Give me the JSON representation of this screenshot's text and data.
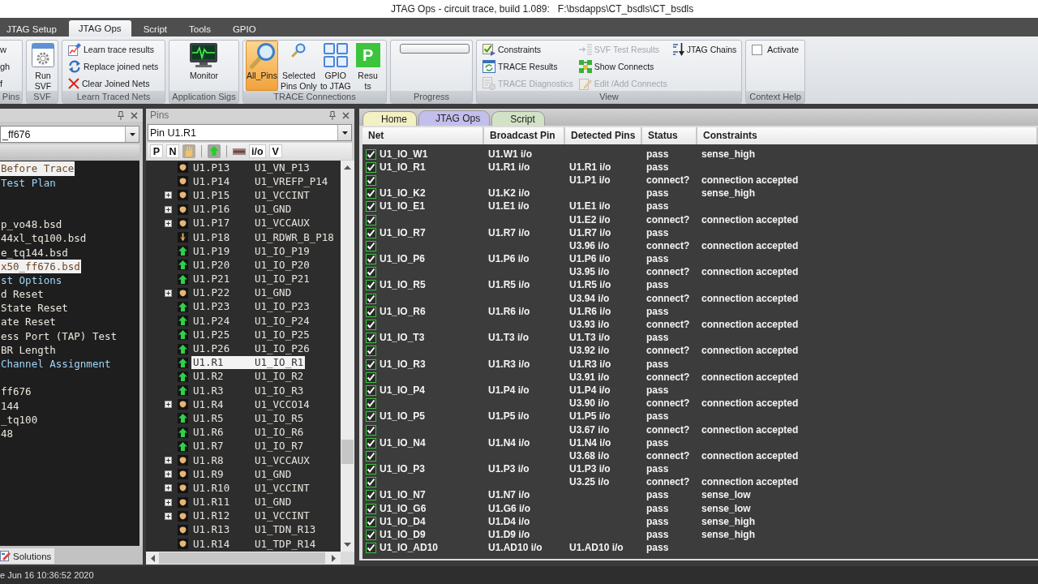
{
  "window": {
    "title": "JTAG Ops - circuit trace, build 1.089:   F:\\bsdapps\\CT_bsdls\\CT_bsdls"
  },
  "ribbon_tabs": [
    {
      "label": "JTAG Setup",
      "selected": false
    },
    {
      "label": "JTAG Ops",
      "selected": true
    },
    {
      "label": "Script",
      "selected": false
    },
    {
      "label": "Tools",
      "selected": false
    },
    {
      "label": "GPIO",
      "selected": false
    }
  ],
  "ribbon_groups": [
    {
      "label": "Pins",
      "items": [
        {
          "kind": "small",
          "label": "w",
          "disabled": false
        },
        {
          "kind": "small",
          "label": "gh",
          "disabled": false
        },
        {
          "kind": "small",
          "label": "f",
          "disabled": false
        }
      ]
    },
    {
      "label": "SVF",
      "items": [
        {
          "kind": "large",
          "label": "Run\nSVF",
          "selected": false
        }
      ]
    },
    {
      "label": "Learn Traced Nets",
      "items": [
        {
          "kind": "small",
          "label": "Learn trace results",
          "disabled": false
        },
        {
          "kind": "small",
          "label": "Replace joined nets",
          "disabled": false
        },
        {
          "kind": "small",
          "label": "Clear Joined Nets",
          "disabled": false
        }
      ]
    },
    {
      "label": "Application Sigs",
      "items": [
        {
          "kind": "large",
          "label": "Monitor",
          "selected": false
        }
      ]
    },
    {
      "label": "TRACE Connections",
      "items": [
        {
          "kind": "large",
          "label": "All_Pins",
          "selected": true
        },
        {
          "kind": "large",
          "label": "Selected\nPins Only",
          "selected": false
        },
        {
          "kind": "large",
          "label": "GPIO\nto JTAG",
          "selected": false
        },
        {
          "kind": "large",
          "label": "Resu\nts",
          "tile": "P",
          "selected": false
        }
      ]
    },
    {
      "label": "Progress",
      "items": [
        {
          "kind": "progress",
          "level": 0
        }
      ]
    },
    {
      "label": "View",
      "items": [
        {
          "kind": "small",
          "label": "Constraints",
          "disabled": false
        },
        {
          "kind": "small",
          "label": "TRACE Results",
          "disabled": false
        },
        {
          "kind": "small",
          "label": "TRACE Diagnostics",
          "disabled": true
        },
        {
          "kind": "small",
          "label": "SVF Test Results",
          "disabled": true
        },
        {
          "kind": "small",
          "label": "Show Connects",
          "disabled": false
        },
        {
          "kind": "small",
          "label": "Edit /Add Connects",
          "disabled": true
        },
        {
          "kind": "small",
          "label": "JTAG Chains",
          "disabled": false
        }
      ]
    },
    {
      "label": "Context Help",
      "items": [
        {
          "kind": "check",
          "label": "Activate",
          "checked": false
        }
      ]
    }
  ],
  "left_panel": {
    "dropdown": "_ff676",
    "sections": [
      {
        "items": [
          {
            "label": "Before Trace",
            "kind": "leaf",
            "selected": true
          },
          {
            "label": "Test Plan",
            "kind": "group",
            "selected": false
          }
        ]
      },
      {
        "items": [
          {
            "label": "p_vo48.bsd",
            "kind": "leaf",
            "selected": false
          },
          {
            "label": "44xl_tq100.bsd",
            "kind": "leaf",
            "selected": false
          },
          {
            "label": "e_tq144.bsd",
            "kind": "leaf",
            "selected": false
          },
          {
            "label": "x50_ff676.bsd",
            "kind": "leaf",
            "selected": true
          },
          {
            "label": "st Options",
            "kind": "group",
            "selected": false
          },
          {
            "label": "d Reset",
            "kind": "leaf",
            "selected": false
          },
          {
            "label": "State Reset",
            "kind": "leaf",
            "selected": false
          },
          {
            "label": "ate Reset",
            "kind": "leaf",
            "selected": false
          },
          {
            "label": "ess Port (TAP) Test",
            "kind": "leaf",
            "selected": false
          },
          {
            "label": "BR Length",
            "kind": "leaf",
            "selected": false
          },
          {
            "label": "Channel Assignment",
            "kind": "group",
            "selected": false
          }
        ]
      },
      {
        "items": [
          {
            "label": "ff676",
            "kind": "leaf",
            "selected": false
          },
          {
            "label": "144",
            "kind": "leaf",
            "selected": false
          },
          {
            "label": "_tq100",
            "kind": "leaf",
            "selected": false
          },
          {
            "label": "48",
            "kind": "leaf",
            "selected": false
          }
        ]
      }
    ],
    "tab": "Solutions"
  },
  "pins_panel": {
    "title": "Pins",
    "dropdown": "Pin U1.R1",
    "toolbar": [
      {
        "kind": "text",
        "label": "P"
      },
      {
        "kind": "text",
        "label": "N"
      },
      {
        "kind": "icon"
      },
      {
        "kind": "separator"
      },
      {
        "kind": "icon"
      },
      {
        "kind": "separator"
      },
      {
        "kind": "icon"
      },
      {
        "kind": "text",
        "label": "i/o"
      },
      {
        "kind": "text",
        "label": "V"
      }
    ],
    "rows": [
      {
        "pin": "U1.P13",
        "net": "U1_VN_P13",
        "kind": "other",
        "expandable": false,
        "selected": false
      },
      {
        "pin": "U1.P14",
        "net": "U1_VREFP_P14",
        "kind": "other",
        "expandable": false,
        "selected": false
      },
      {
        "pin": "U1.P15",
        "net": "U1_VCCINT",
        "kind": "other",
        "expandable": true,
        "selected": false
      },
      {
        "pin": "U1.P16",
        "net": "U1_GND",
        "kind": "other",
        "expandable": true,
        "selected": false
      },
      {
        "pin": "U1.P17",
        "net": "U1_VCCAUX",
        "kind": "other",
        "expandable": true,
        "selected": false
      },
      {
        "pin": "U1.P18",
        "net": "U1_RDWR_B_P18",
        "kind": "input",
        "expandable": false,
        "selected": false
      },
      {
        "pin": "U1.P19",
        "net": "U1_IO_P19",
        "kind": "io",
        "expandable": false,
        "selected": false
      },
      {
        "pin": "U1.P20",
        "net": "U1_IO_P20",
        "kind": "io",
        "expandable": false,
        "selected": false
      },
      {
        "pin": "U1.P21",
        "net": "U1_IO_P21",
        "kind": "io",
        "expandable": false,
        "selected": false
      },
      {
        "pin": "U1.P22",
        "net": "U1_GND",
        "kind": "other",
        "expandable": true,
        "selected": false
      },
      {
        "pin": "U1.P23",
        "net": "U1_IO_P23",
        "kind": "io",
        "expandable": false,
        "selected": false
      },
      {
        "pin": "U1.P24",
        "net": "U1_IO_P24",
        "kind": "io",
        "expandable": false,
        "selected": false
      },
      {
        "pin": "U1.P25",
        "net": "U1_IO_P25",
        "kind": "io",
        "expandable": false,
        "selected": false
      },
      {
        "pin": "U1.P26",
        "net": "U1_IO_P26",
        "kind": "io",
        "expandable": false,
        "selected": false
      },
      {
        "pin": "U1.R1",
        "net": "U1_IO_R1",
        "kind": "io",
        "expandable": false,
        "selected": true
      },
      {
        "pin": "U1.R2",
        "net": "U1_IO_R2",
        "kind": "io",
        "expandable": false,
        "selected": false
      },
      {
        "pin": "U1.R3",
        "net": "U1_IO_R3",
        "kind": "io",
        "expandable": false,
        "selected": false
      },
      {
        "pin": "U1.R4",
        "net": "U1_VCCO14",
        "kind": "other",
        "expandable": true,
        "selected": false
      },
      {
        "pin": "U1.R5",
        "net": "U1_IO_R5",
        "kind": "io",
        "expandable": false,
        "selected": false
      },
      {
        "pin": "U1.R6",
        "net": "U1_IO_R6",
        "kind": "io",
        "expandable": false,
        "selected": false
      },
      {
        "pin": "U1.R7",
        "net": "U1_IO_R7",
        "kind": "io",
        "expandable": false,
        "selected": false
      },
      {
        "pin": "U1.R8",
        "net": "U1_VCCAUX",
        "kind": "other",
        "expandable": true,
        "selected": false
      },
      {
        "pin": "U1.R9",
        "net": "U1_GND",
        "kind": "other",
        "expandable": true,
        "selected": false
      },
      {
        "pin": "U1.R10",
        "net": "U1_VCCINT",
        "kind": "other",
        "expandable": true,
        "selected": false
      },
      {
        "pin": "U1.R11",
        "net": "U1_GND",
        "kind": "other",
        "expandable": true,
        "selected": false
      },
      {
        "pin": "U1.R12",
        "net": "U1_VCCINT",
        "kind": "other",
        "expandable": true,
        "selected": false
      },
      {
        "pin": "U1.R13",
        "net": "U1_TDN_R13",
        "kind": "other",
        "expandable": false,
        "selected": false
      },
      {
        "pin": "U1.R14",
        "net": "U1_TDP_R14",
        "kind": "other",
        "expandable": false,
        "selected": false
      }
    ]
  },
  "document_tabs": [
    {
      "label": "Home",
      "selected": false,
      "color": "#f3f0c4"
    },
    {
      "label": "JTAG Ops",
      "selected": true,
      "color": "#c3bfec"
    },
    {
      "label": "Script",
      "selected": false,
      "color": "#d2e2c6"
    }
  ],
  "table": {
    "columns": [
      {
        "label": "Net"
      },
      {
        "label": "Broadcast Pin"
      },
      {
        "label": "Detected Pins"
      },
      {
        "label": "Status"
      },
      {
        "label": "Constraints"
      }
    ],
    "rows": [
      {
        "checked": true,
        "net": "U1_IO_W1",
        "broadcast_pin": "U1.W1 i/o",
        "status": "pass",
        "constraints": "sense_high"
      },
      {
        "checked": true,
        "net": "U1_IO_R1",
        "broadcast_pin": "U1.R1 i/o",
        "detected_pins": "U1.R1 i/o",
        "status": "pass"
      },
      {
        "checked": true,
        "detected_pins": "U1.P1 i/o",
        "status": "connect?",
        "constraints": "connection accepted"
      },
      {
        "checked": true,
        "net": "U1_IO_K2",
        "broadcast_pin": "U1.K2 i/o",
        "status": "pass",
        "constraints": "sense_high"
      },
      {
        "checked": true,
        "net": "U1_IO_E1",
        "broadcast_pin": "U1.E1 i/o",
        "detected_pins": "U1.E1 i/o",
        "status": "pass"
      },
      {
        "checked": true,
        "detected_pins": "U1.E2 i/o",
        "status": "connect?",
        "constraints": "connection accepted"
      },
      {
        "checked": true,
        "net": "U1_IO_R7",
        "broadcast_pin": "U1.R7 i/o",
        "detected_pins": "U1.R7 i/o",
        "status": "pass"
      },
      {
        "checked": true,
        "detected_pins": "U3.96 i/o",
        "status": "connect?",
        "constraints": "connection accepted"
      },
      {
        "checked": true,
        "net": "U1_IO_P6",
        "broadcast_pin": "U1.P6 i/o",
        "detected_pins": "U1.P6 i/o",
        "status": "pass"
      },
      {
        "checked": true,
        "detected_pins": "U3.95 i/o",
        "status": "connect?",
        "constraints": "connection accepted"
      },
      {
        "checked": true,
        "net": "U1_IO_R5",
        "broadcast_pin": "U1.R5 i/o",
        "detected_pins": "U1.R5 i/o",
        "status": "pass"
      },
      {
        "checked": true,
        "detected_pins": "U3.94 i/o",
        "status": "connect?",
        "constraints": "connection accepted"
      },
      {
        "checked": true,
        "net": "U1_IO_R6",
        "broadcast_pin": "U1.R6 i/o",
        "detected_pins": "U1.R6 i/o",
        "status": "pass"
      },
      {
        "checked": true,
        "detected_pins": "U3.93 i/o",
        "status": "connect?",
        "constraints": "connection accepted"
      },
      {
        "checked": true,
        "net": "U1_IO_T3",
        "broadcast_pin": "U1.T3 i/o",
        "detected_pins": "U1.T3 i/o",
        "status": "pass"
      },
      {
        "checked": true,
        "detected_pins": "U3.92 i/o",
        "status": "connect?",
        "constraints": "connection accepted"
      },
      {
        "checked": true,
        "net": "U1_IO_R3",
        "broadcast_pin": "U1.R3 i/o",
        "detected_pins": "U1.R3 i/o",
        "status": "pass"
      },
      {
        "checked": true,
        "detected_pins": "U3.91 i/o",
        "status": "connect?",
        "constraints": "connection accepted"
      },
      {
        "checked": true,
        "net": "U1_IO_P4",
        "broadcast_pin": "U1.P4 i/o",
        "detected_pins": "U1.P4 i/o",
        "status": "pass"
      },
      {
        "checked": true,
        "detected_pins": "U3.90 i/o",
        "status": "connect?",
        "constraints": "connection accepted"
      },
      {
        "checked": true,
        "net": "U1_IO_P5",
        "broadcast_pin": "U1.P5 i/o",
        "detected_pins": "U1.P5 i/o",
        "status": "pass"
      },
      {
        "checked": true,
        "detected_pins": "U3.67 i/o",
        "status": "connect?",
        "constraints": "connection accepted"
      },
      {
        "checked": true,
        "net": "U1_IO_N4",
        "broadcast_pin": "U1.N4 i/o",
        "detected_pins": "U1.N4 i/o",
        "status": "pass"
      },
      {
        "checked": true,
        "detected_pins": "U3.68 i/o",
        "status": "connect?",
        "constraints": "connection accepted"
      },
      {
        "checked": true,
        "net": "U1_IO_P3",
        "broadcast_pin": "U1.P3 i/o",
        "detected_pins": "U1.P3 i/o",
        "status": "pass"
      },
      {
        "checked": true,
        "detected_pins": "U3.25 i/o",
        "status": "connect?",
        "constraints": "connection accepted"
      },
      {
        "checked": true,
        "net": "U1_IO_N7",
        "broadcast_pin": "U1.N7 i/o",
        "status": "pass",
        "constraints": "sense_low"
      },
      {
        "checked": true,
        "net": "U1_IO_G6",
        "broadcast_pin": "U1.G6 i/o",
        "status": "pass",
        "constraints": "sense_low"
      },
      {
        "checked": true,
        "net": "U1_IO_D4",
        "broadcast_pin": "U1.D4 i/o",
        "status": "pass",
        "constraints": "sense_high"
      },
      {
        "checked": true,
        "net": "U1_IO_D9",
        "broadcast_pin": "U1.D9 i/o",
        "status": "pass",
        "constraints": "sense_high"
      },
      {
        "checked": true,
        "net": "U1_IO_AD10",
        "broadcast_pin": "U1.AD10 i/o",
        "detected_pins": "U1.AD10 i/o",
        "status": "pass"
      }
    ]
  },
  "status_bar": {
    "text": "e Jun 16 10:36:52 2020"
  }
}
